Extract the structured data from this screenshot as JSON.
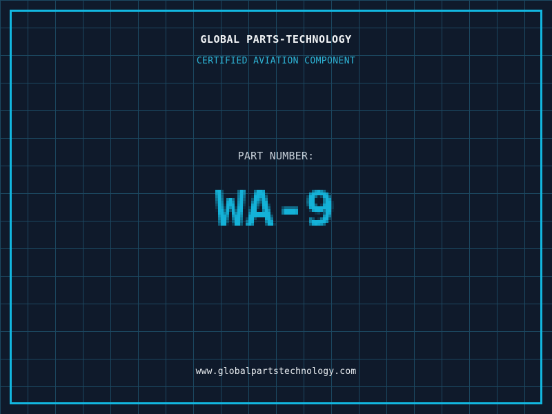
{
  "page": {
    "header": {
      "title": "GLOBAL PARTS-TECHNOLOGY",
      "subtitle": "CERTIFIED AVIATION COMPONENT"
    },
    "part": {
      "label": "PART NUMBER:",
      "number": "WA-9"
    },
    "footer": {
      "website": "www.globalpartstechnology.com"
    },
    "colors": {
      "background": "#0f1a2b",
      "grid_line": "#1c4861",
      "frame": "#12b7e0",
      "title": "#f2f4f6",
      "subtitle": "#2eb6d8",
      "part_label": "#c6cfd8",
      "part_number": "#14b2d8",
      "website": "#e8ecf0"
    }
  }
}
